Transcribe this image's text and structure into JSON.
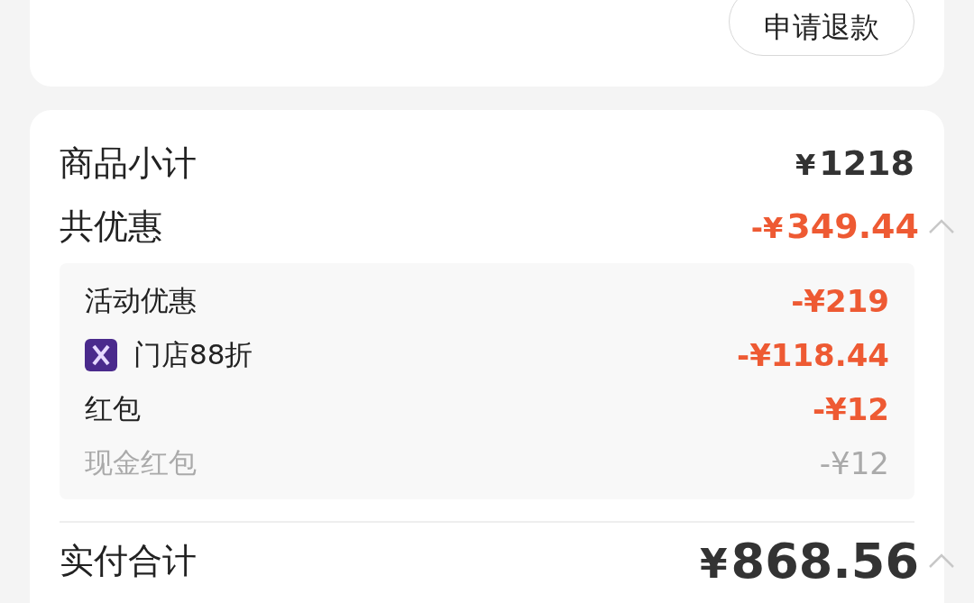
{
  "refund_button": {
    "label": "申请退款"
  },
  "summary": {
    "subtotal": {
      "label": "商品小计",
      "currency": "¥",
      "amount": "1218"
    },
    "discount": {
      "label": "共优惠",
      "sign": "-",
      "currency": "¥",
      "amount": "349.44",
      "expanded": true
    },
    "discount_items": [
      {
        "kind": "activity",
        "label": "活动优惠",
        "value": "-¥219"
      },
      {
        "kind": "store",
        "label": "门店88折",
        "value": "-¥118.44"
      },
      {
        "kind": "redpacket",
        "label": "红包",
        "value": "-¥12",
        "children": [
          {
            "label": "现金红包",
            "value": "-¥12"
          }
        ]
      }
    ],
    "total": {
      "label": "实付合计",
      "currency": "¥",
      "amount": "868.56",
      "expanded": true
    }
  }
}
